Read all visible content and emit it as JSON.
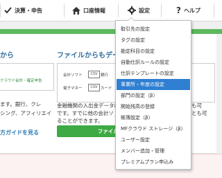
{
  "nav": {
    "items": [
      {
        "label": "決算・申告",
        "icon": "check-icon"
      },
      {
        "label": "口座情報",
        "icon": "home-icon"
      },
      {
        "label": "設定",
        "icon": "gear-icon"
      },
      {
        "label": "ヘルプ",
        "icon": "question-icon"
      }
    ]
  },
  "main": {
    "left_title": "から",
    "left_mfc": "クラウド会計・確定申告",
    "left_lines": [
      "ます。銀行、クレ",
      "シング、アフィリエイ"
    ],
    "left_link": "方ガイドを見る",
    "right_title": "ファイルからもデー",
    "csv_labels": [
      "会計ソフト",
      "銀行",
      "電子マネー",
      "カード"
    ],
    "csv_badge": "CSV",
    "right_lines": [
      "金融機関の入出金データは",
      "です。すでに他の会計ソ",
      "ることができます。"
    ],
    "right_overflow": [
      "も可",
      "とも可"
    ],
    "import_button": "ファイルから取り込"
  },
  "menu": {
    "active_index": 6,
    "items": [
      "取引先の設定",
      "タグの設定",
      "勘定科目の設定",
      "自動仕訳ルールの設定",
      "仕訳テンプレートの設定",
      "事業所・年度の設定",
      "部門の設定（β）",
      "開始残高の登録",
      "帳簿設定（β）",
      "MFクラウド ストレージ（β）",
      "ユーザー設定",
      "メンバー追加・管理",
      "プレミアムプラン申込み"
    ]
  },
  "colors": {
    "accent_green": "#3eaa43",
    "menu_highlight": "#2f7fd2",
    "title_blue": "#2f6d9e"
  }
}
